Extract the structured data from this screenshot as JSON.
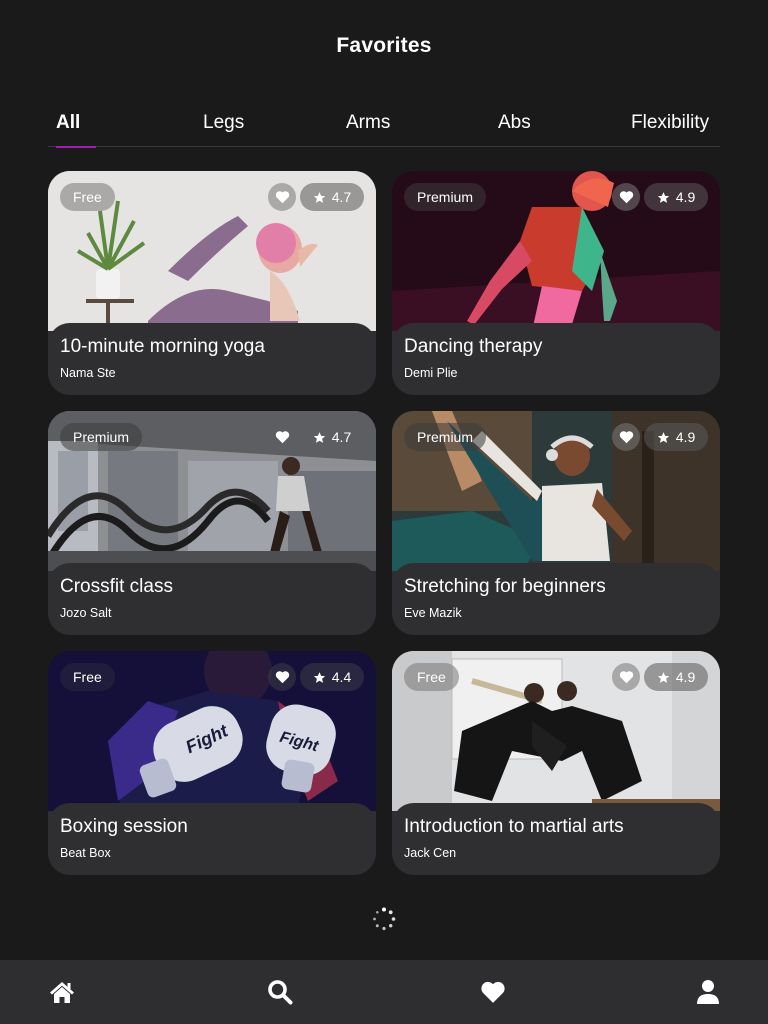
{
  "header": {
    "title": "Favorites"
  },
  "tabs": [
    {
      "label": "All",
      "active": true
    },
    {
      "label": "Legs"
    },
    {
      "label": "Arms"
    },
    {
      "label": "Abs"
    },
    {
      "label": "Flexibility"
    }
  ],
  "cards": [
    {
      "title": "10-minute morning yoga",
      "author": "Nama Ste",
      "badge": "Free",
      "rating": "4.7"
    },
    {
      "title": "Dancing therapy",
      "author": "Demi Plie",
      "badge": "Premium",
      "rating": "4.9"
    },
    {
      "title": "Crossfit class",
      "author": "Jozo Salt",
      "badge": "Premium",
      "rating": "4.7"
    },
    {
      "title": "Stretching for beginners",
      "author": "Eve Mazik",
      "badge": "Premium",
      "rating": "4.9"
    },
    {
      "title": "Boxing session",
      "author": "Beat Box",
      "badge": "Free",
      "rating": "4.4"
    },
    {
      "title": "Introduction to martial arts",
      "author": "Jack Cen",
      "badge": "Free",
      "rating": "4.9"
    }
  ],
  "icons": {
    "favorite": "heart-icon",
    "rating": "star-icon",
    "loading": "spinner-icon",
    "nav": [
      "home-icon",
      "search-icon",
      "heart-icon",
      "user-icon"
    ]
  },
  "colors": {
    "background": "#1a1a1b",
    "card": "#2f2f31",
    "accent": "#a21caf",
    "nav": "#2e2e30"
  }
}
